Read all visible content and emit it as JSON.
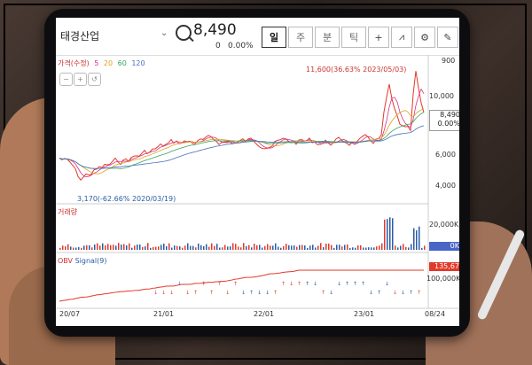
{
  "stock": {
    "name": "태경산업",
    "price": "8,490",
    "change": "0",
    "change_pct": "0.00%"
  },
  "tabs": [
    "일",
    "주",
    "분",
    "틱"
  ],
  "tools": [
    "crosshair-icon",
    "indicator-icon",
    "settings-icon",
    "pin-icon"
  ],
  "legend": {
    "label": "가격(수정)",
    "ma": [
      "5",
      "20",
      "60",
      "120"
    ]
  },
  "price_axis": [
    "900",
    "10,000",
    "8,490",
    "0.00%",
    "6,000",
    "4,000"
  ],
  "notes": {
    "high": "11,600(36.63% 2023/05/03)",
    "low": "3,170(-62.66% 2020/03/19)"
  },
  "volume": {
    "label": "거래량",
    "axis": "20,000K",
    "tag": "0K"
  },
  "obv": {
    "label": "OBV",
    "signal": "Signal(9)",
    "axis": "100,000K",
    "tag": "135,67"
  },
  "x_axis": [
    "20/07",
    "21/01",
    "22/01",
    "23/01",
    "08/24"
  ],
  "colors": {
    "up": "#e23a2a",
    "down": "#2a5ba8",
    "ma5": "#d63384",
    "ma20": "#e0a020",
    "ma60": "#3aa060",
    "ma120": "#4a70c0"
  }
}
